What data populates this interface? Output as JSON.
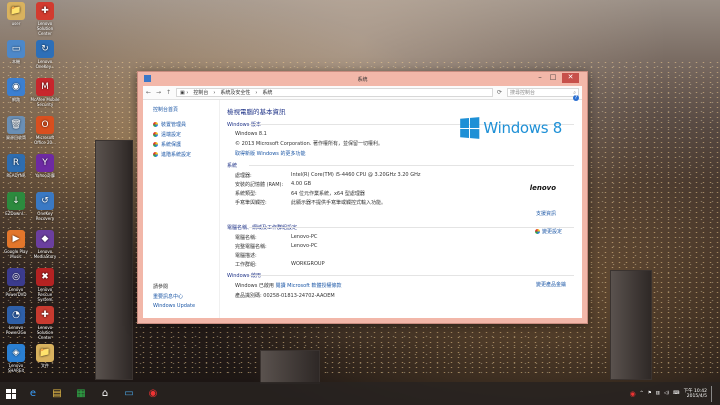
{
  "window": {
    "title": "系統",
    "breadcrumbs": [
      "控制台",
      "系統及安全性",
      "系統"
    ],
    "search_placeholder": "搜尋控制台"
  },
  "sidebar": {
    "home": "控制台首頁",
    "links": [
      "裝置管理員",
      "遠端設定",
      "系統保護",
      "進階系統設定"
    ],
    "see_also": "請參閱",
    "bottom_links": [
      "重要訊息中心",
      "Windows Update"
    ]
  },
  "main": {
    "heading": "檢視電腦的基本資訊",
    "edition": {
      "section": "Windows 版本",
      "name": "Windows 8.1",
      "copyright": "© 2013 Microsoft Corporation. 著作權所有，並保留一切權利。",
      "more_link": "取得新版 Windows 的更多功能"
    },
    "system": {
      "section": "系統",
      "rows": [
        {
          "k": "處理器:",
          "v": "Intel(R) Core(TM) i5-4460  CPU @ 3.20GHz   3.20 GHz"
        },
        {
          "k": "安裝的記憶體 (RAM):",
          "v": "4.00 GB"
        },
        {
          "k": "系統類型:",
          "v": "64 位元作業系統，x64 型處理器"
        },
        {
          "k": "手寫筆與觸控:",
          "v": "此顯示器不提供手寫筆或觸控式輸入功能。"
        }
      ],
      "support_link": "支援資訊"
    },
    "computer": {
      "section": "電腦名稱、網域及工作群組設定",
      "rows": [
        {
          "k": "電腦名稱:",
          "v": "Lenovo-PC"
        },
        {
          "k": "完整電腦名稱:",
          "v": "Lenovo-PC"
        },
        {
          "k": "電腦描述:",
          "v": ""
        },
        {
          "k": "工作群組:",
          "v": "WORKGROUP"
        }
      ],
      "change_link": "變更設定"
    },
    "activation": {
      "section": "Windows 啟用",
      "status": "Windows 已啟用",
      "terms_link": "閱讀 Microsoft 軟體授權條款",
      "product_id": "產品識別碼: 00258-01813-24702-AAOEM",
      "product_key_link": "變更產品金鑰"
    },
    "logo_text": "Windows 8",
    "oem_logo": "lenovo"
  },
  "desktop": {
    "icons": [
      {
        "label": "user",
        "color": "#d9b25e",
        "glyph": "📁"
      },
      {
        "label": "Lenovo Solution Center",
        "color": "#d23b2f",
        "glyph": "✚"
      },
      {
        "label": "本機",
        "color": "#4d88c9",
        "glyph": "▭"
      },
      {
        "label": "Lenovo OneKey...",
        "color": "#2d6fb8",
        "glyph": "↻"
      },
      {
        "label": "網路",
        "color": "#3b7fd1",
        "glyph": "◉"
      },
      {
        "label": "McAfee Mobile Security",
        "color": "#c8262c",
        "glyph": "M"
      },
      {
        "label": "資源回收筒",
        "color": "#6a8fb5",
        "glyph": "🗑"
      },
      {
        "label": "Microsoft Office 20...",
        "color": "#d94f1e",
        "glyph": "O"
      },
      {
        "label": "READYNR",
        "color": "#2e6db0",
        "glyph": "R"
      },
      {
        "label": "Yahoo奇摩",
        "color": "#6e2aa3",
        "glyph": "Y"
      },
      {
        "label": "EZDownl...",
        "color": "#2c8a3e",
        "glyph": "↓"
      },
      {
        "label": "OneKey Recovery",
        "color": "#3a79c4",
        "glyph": "↺"
      },
      {
        "label": "Google Play Music",
        "color": "#e2762b",
        "glyph": "▶"
      },
      {
        "label": "Lenovo MediaStory",
        "color": "#6b3fa0",
        "glyph": "◆"
      },
      {
        "label": "Lenovo PowerDVD",
        "color": "#3b3b8e",
        "glyph": "◎"
      },
      {
        "label": "Lenovo Rescue System",
        "color": "#b42222",
        "glyph": "✖"
      },
      {
        "label": "Lenovo Power2Go",
        "color": "#2e5fa8",
        "glyph": "◔"
      },
      {
        "label": "Lenovo Solution Center",
        "color": "#c83a2f",
        "glyph": "✚"
      },
      {
        "label": "Lenovo SHAREit",
        "color": "#2a7fd2",
        "glyph": "◈"
      },
      {
        "label": "文件",
        "color": "#d9b25e",
        "glyph": "📁"
      }
    ]
  },
  "taskbar": {
    "apps": [
      "IE",
      "檔案總管",
      "市集",
      "首頁",
      "公用程式",
      "McAfee"
    ],
    "time": "下午 10:42",
    "date": "2015/4/5"
  }
}
